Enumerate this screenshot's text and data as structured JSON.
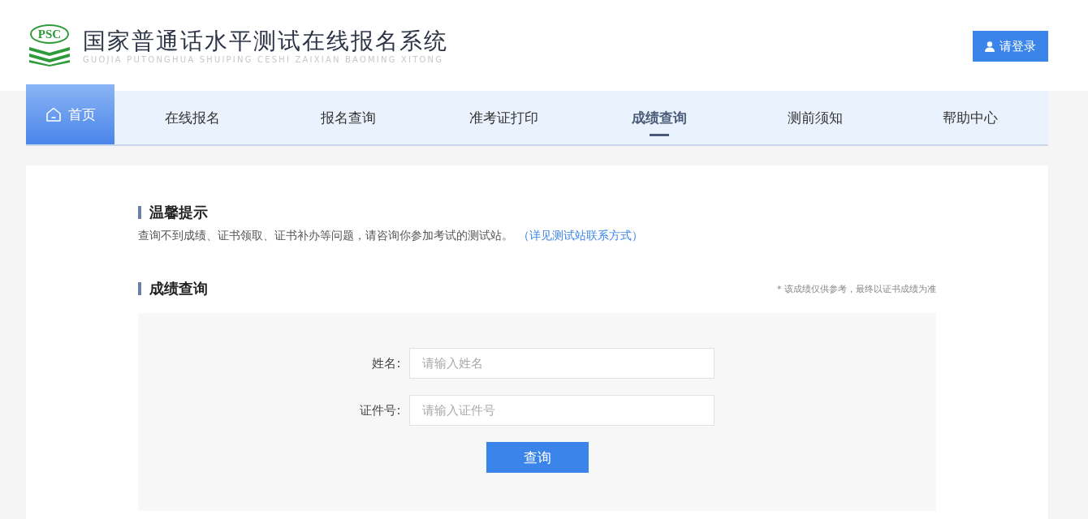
{
  "header": {
    "logo_text": "PSC",
    "title": "国家普通话水平测试在线报名系统",
    "subtitle": "GUOJIA PUTONGHUA SHUIPING CESHI ZAIXIAN BAOMING XITONG",
    "login_button": "请登录"
  },
  "nav": [
    {
      "label": "首页",
      "kind": "home",
      "selected": false
    },
    {
      "label": "在线报名",
      "kind": "link",
      "selected": false
    },
    {
      "label": "报名查询",
      "kind": "link",
      "selected": false
    },
    {
      "label": "准考证打印",
      "kind": "link",
      "selected": false
    },
    {
      "label": "成绩查询",
      "kind": "link",
      "selected": true
    },
    {
      "label": "测前须知",
      "kind": "link",
      "selected": false
    },
    {
      "label": "帮助中心",
      "kind": "link",
      "selected": false
    }
  ],
  "notice": {
    "heading": "温馨提示",
    "text": "查询不到成绩、证书领取、证书补办等问题，请咨询你参加考试的测试站。",
    "link": "（详见测试站联系方式）"
  },
  "query": {
    "heading": "成绩查询",
    "note": "* 该成绩仅供参考，最终以证书成绩为准",
    "fields": [
      {
        "label": "姓名:",
        "placeholder": "请输入姓名"
      },
      {
        "label": "证件号:",
        "placeholder": "请输入证件号"
      }
    ],
    "button": "查询"
  }
}
